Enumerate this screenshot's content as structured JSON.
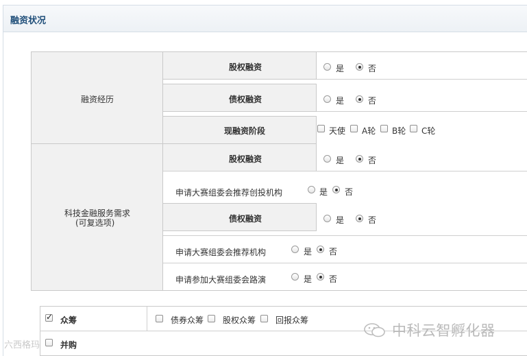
{
  "title": "融资状况",
  "sections": {
    "experience": {
      "label": "融资经历",
      "equity": {
        "label": "股权融资",
        "yes": "是",
        "no": "否"
      },
      "debt": {
        "label": "债权融资",
        "yes": "是",
        "no": "否"
      },
      "stage": {
        "label": "现融资阶段",
        "options": [
          "天使",
          "A轮",
          "B轮",
          "C轮"
        ]
      }
    },
    "needs": {
      "label_line1": "科技金融服务需求",
      "label_line2": "(可复选项)",
      "equity": {
        "label": "股权融资",
        "yes": "是",
        "no": "否"
      },
      "recommend_vc": {
        "label": "申请大赛组委会推荐创投机构",
        "yes": "是",
        "no": "否"
      },
      "debt": {
        "label": "债权融资",
        "yes": "是",
        "no": "否"
      },
      "recommend_inst": {
        "label": "申请大赛组委会推荐机构",
        "yes": "是",
        "no": "否"
      },
      "roadshow": {
        "label": "申请参加大赛组委会路演",
        "yes": "是",
        "no": "否"
      }
    },
    "crowd": {
      "label": "众筹",
      "options": [
        "债券众筹",
        "股权众筹",
        "回报众筹"
      ]
    },
    "merger": {
      "label": "并购"
    }
  },
  "watermark": "中科云智孵化器",
  "watermark_left": "六西格玛"
}
